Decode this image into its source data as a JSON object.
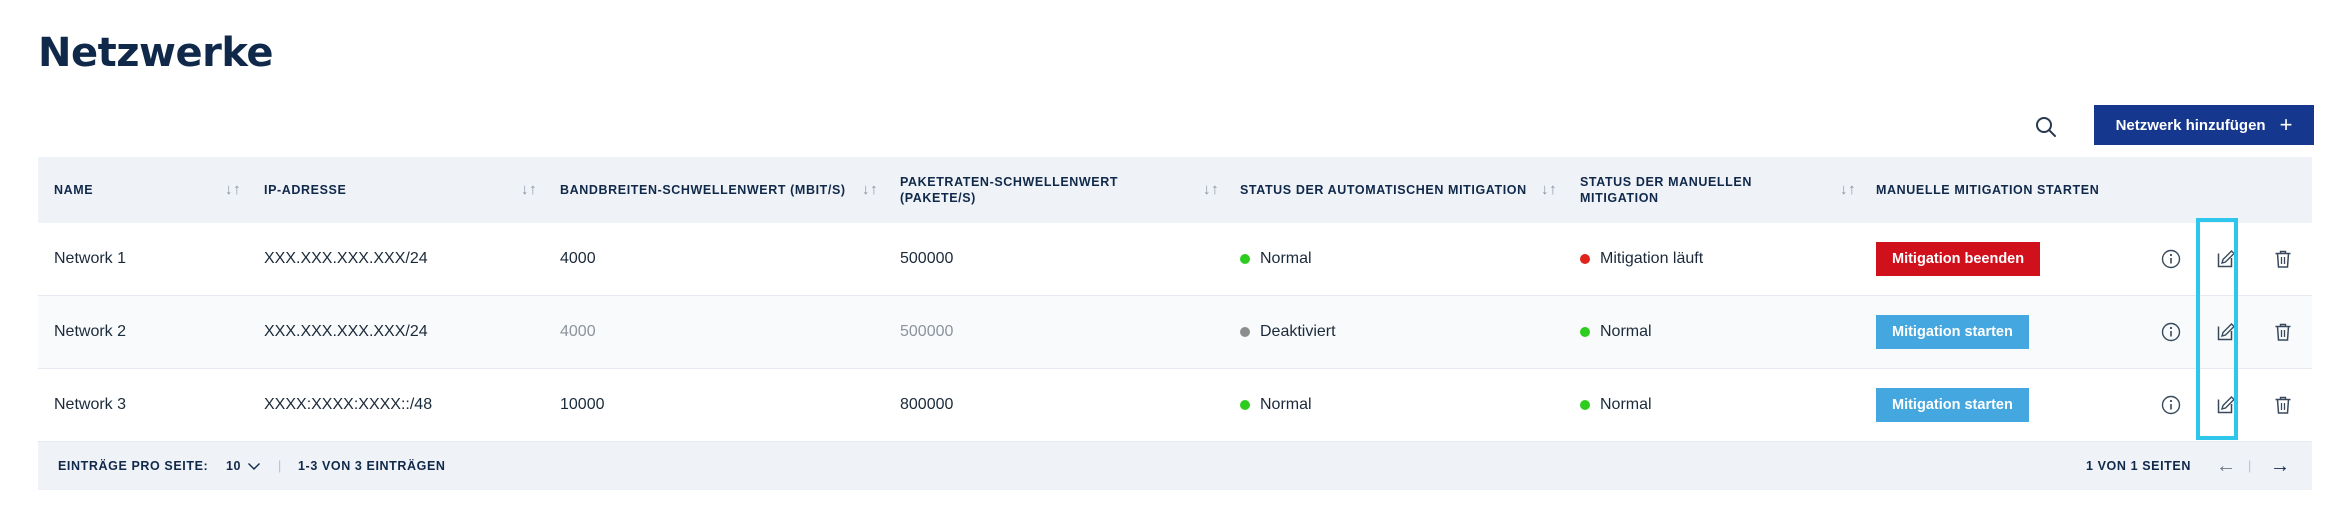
{
  "page": {
    "title": "Netzwerke"
  },
  "toolbar": {
    "search_icon": "search-icon",
    "add_label": "Netzwerk hinzufügen",
    "add_icon": "+"
  },
  "table": {
    "columns": [
      "NAME",
      "IP-ADRESSE",
      "BANDBREITEN-SCHWELLENWERT (MBIT/S)",
      "PAKETRATEN-SCHWELLENWERT (PAKETE/S)",
      "STATUS DER AUTOMATISCHEN MITIGATION",
      "STATUS DER MANUELLEN MITIGATION",
      "MANUELLE MITIGATION STARTEN"
    ],
    "rows": [
      {
        "name": "Network 1",
        "ip": "XXX.XXX.XXX.XXX/24",
        "bandwidth": "4000",
        "packetrate": "500000",
        "auto_status": "Normal",
        "auto_color": "#2ecc1f",
        "manual_status": "Mitigation läuft",
        "manual_color": "#e0231b",
        "action_label": "Mitigation beenden",
        "action_color": "#d0101b"
      },
      {
        "name": "Network 2",
        "ip": "XXX.XXX.XXX.XXX/24",
        "bandwidth": "4000",
        "packetrate": "500000",
        "auto_status": "Deaktiviert",
        "auto_color": "#8c8c8c",
        "manual_status": "Normal",
        "manual_color": "#2ecc1f",
        "action_label": "Mitigation starten",
        "action_color": "#45a7df"
      },
      {
        "name": "Network 3",
        "ip": "XXXX:XXXX:XXXX::/48",
        "bandwidth": "10000",
        "packetrate": "800000",
        "auto_status": "Normal",
        "auto_color": "#2ecc1f",
        "manual_status": "Normal",
        "manual_color": "#2ecc1f",
        "action_label": "Mitigation starten",
        "action_color": "#45a7df"
      }
    ],
    "row_icons": [
      "info-icon",
      "edit-icon",
      "trash-icon"
    ]
  },
  "footer": {
    "per_page_label": "EINTRÄGE PRO SEITE:",
    "per_page_value": "10",
    "range_text": "1-3 VON 3 EINTRÄGEN",
    "pages_text": "1 VON 1 SEITEN",
    "prev_icon": "←",
    "next_icon": "→"
  },
  "colors": {
    "brand": "#15378e",
    "header_bg": "#eff2f7",
    "highlight": "#2fc6ec"
  }
}
